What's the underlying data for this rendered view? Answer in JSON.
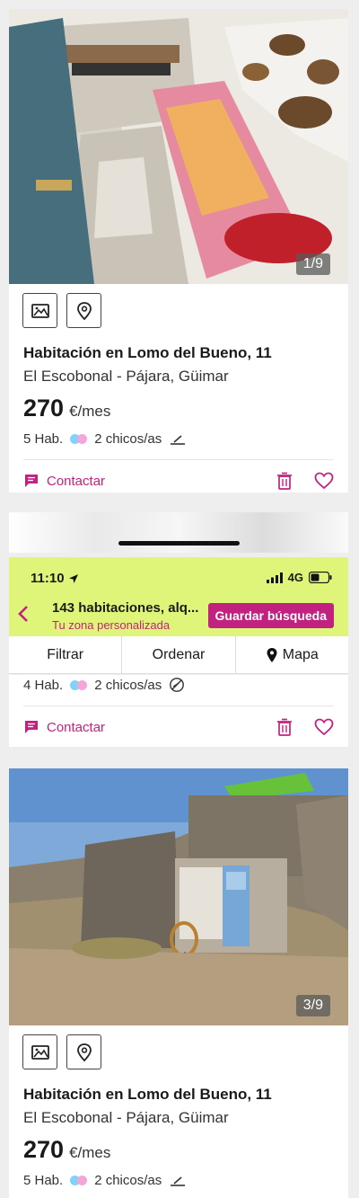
{
  "card1": {
    "photo_counter": "1/9",
    "title": "Habitación en Lomo del Bueno, 11",
    "location": "El Escobonal - Pájara, Güimar",
    "price": "270",
    "price_unit": "€/mes",
    "rooms": "5 Hab.",
    "gender": "2 chicos/as",
    "contact_label": "Contactar"
  },
  "status_bar": {
    "time": "11:10",
    "network": "4G"
  },
  "search_header": {
    "title": "143 habitaciones, alq...",
    "subtitle": "Tu zona personalizada",
    "save_label": "Guardar búsqueda"
  },
  "toolbar": {
    "filter": "Filtrar",
    "sort": "Ordenar",
    "map": "Mapa"
  },
  "card2": {
    "rooms": "4 Hab.",
    "gender": "2 chicos/as",
    "contact_label": "Contactar"
  },
  "card3": {
    "photo_counter": "3/9",
    "title": "Habitación en Lomo del Bueno, 11",
    "location": "El Escobonal - Pájara, Güimar",
    "price": "270",
    "price_unit": "€/mes",
    "rooms": "5 Hab.",
    "gender": "2 chicos/as"
  },
  "colors": {
    "accent": "#c2227f",
    "header_bg": "#dff57a",
    "dot_blue": "#7fd3f7",
    "dot_pink": "#f4a6d8"
  }
}
